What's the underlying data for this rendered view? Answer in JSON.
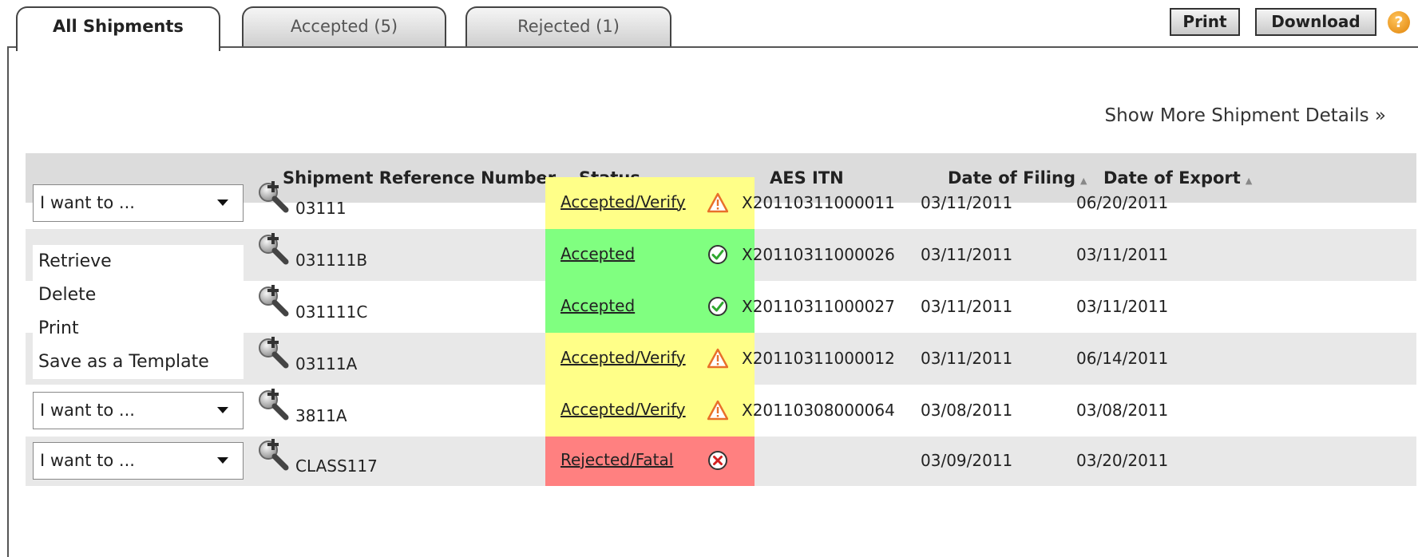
{
  "tabs": [
    {
      "label": "All Shipments"
    },
    {
      "label": "Accepted (5)"
    },
    {
      "label": "Rejected (1)"
    }
  ],
  "toolbar": {
    "print_label": "Print",
    "download_label": "Download",
    "help_label": "?"
  },
  "more_details_link": "Show More Shipment Details »",
  "table": {
    "columns": [
      "Shipment Reference Number",
      "Status",
      "AES ITN",
      "Date of Filing",
      "Date of Export"
    ],
    "sort_glyph": "▲",
    "rows": [
      {
        "action": "I want to ...",
        "ref": "03111",
        "status": "Accepted/Verify",
        "status_type": "warning",
        "itn": "X20110311000011",
        "filing": "03/11/2011",
        "export": "06/20/2011"
      },
      {
        "action": "",
        "ref": "031111B",
        "status": "Accepted",
        "status_type": "ok",
        "itn": "X20110311000026",
        "filing": "03/11/2011",
        "export": "03/11/2011"
      },
      {
        "action": "",
        "ref": "031111C",
        "status": "Accepted",
        "status_type": "ok",
        "itn": "X20110311000027",
        "filing": "03/11/2011",
        "export": "03/11/2011"
      },
      {
        "action": "I want to ...",
        "ref": "03111A",
        "status": "Accepted/Verify",
        "status_type": "warning",
        "itn": "X20110311000012",
        "filing": "03/11/2011",
        "export": "06/14/2011"
      },
      {
        "action": "I want to ...",
        "ref": "3811A",
        "status": "Accepted/Verify",
        "status_type": "warning",
        "itn": "X20110308000064",
        "filing": "03/08/2011",
        "export": "03/08/2011"
      },
      {
        "action": "I want to ...",
        "ref": "CLASS117",
        "status": "Rejected/Fatal",
        "status_type": "error",
        "itn": "",
        "filing": "03/09/2011",
        "export": "03/20/2011"
      }
    ]
  },
  "dropdown_menu": [
    "Retrieve",
    "Delete",
    "Print",
    "Save as a Template"
  ],
  "colors": {
    "warning": "#ffff88",
    "ok": "#80ff80",
    "error": "#ff8080"
  },
  "icons": {
    "warning": "warning-icon",
    "ok": "check-circle-icon",
    "error": "error-circle-icon",
    "magnify": "magnify-plus-icon"
  }
}
